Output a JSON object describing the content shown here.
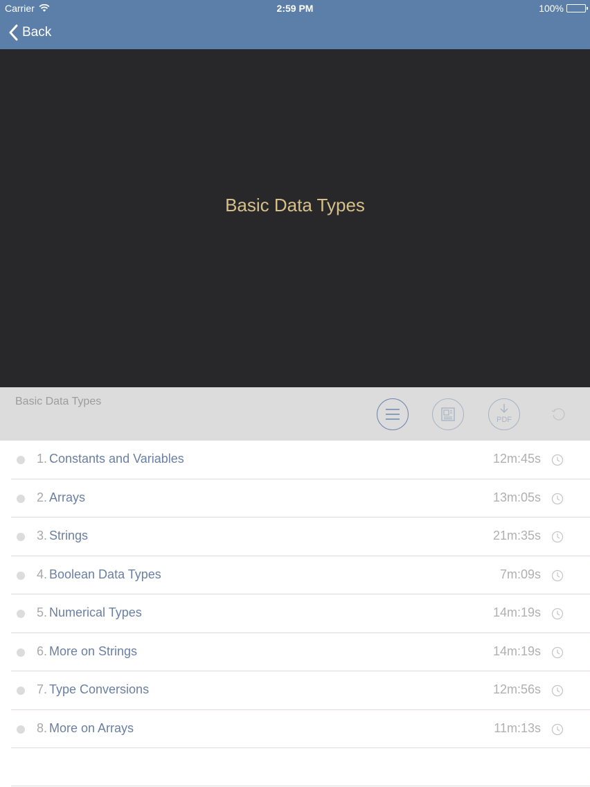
{
  "status_bar": {
    "carrier": "Carrier",
    "time": "2:59 PM",
    "battery": "100%"
  },
  "nav": {
    "back_label": "Back"
  },
  "video": {
    "title": "Basic Data Types"
  },
  "toolbar": {
    "title": "Basic Data Types",
    "pdf_label": "PDF"
  },
  "lessons": [
    {
      "number": "1.",
      "title": "Constants and Variables",
      "duration": "12m:45s"
    },
    {
      "number": "2.",
      "title": "Arrays",
      "duration": "13m:05s"
    },
    {
      "number": "3.",
      "title": "Strings",
      "duration": "21m:35s"
    },
    {
      "number": "4.",
      "title": "Boolean Data Types",
      "duration": "7m:09s"
    },
    {
      "number": "5.",
      "title": "Numerical Types",
      "duration": "14m:19s"
    },
    {
      "number": "6.",
      "title": "More on Strings",
      "duration": "14m:19s"
    },
    {
      "number": "7.",
      "title": "Type Conversions",
      "duration": "12m:56s"
    },
    {
      "number": "8.",
      "title": "More on Arrays",
      "duration": "11m:13s"
    }
  ],
  "colors": {
    "nav_bar": "#5b7fa8",
    "video_bg": "#282729",
    "video_title": "#d5c08a",
    "lesson_title": "#6a7fa3"
  }
}
